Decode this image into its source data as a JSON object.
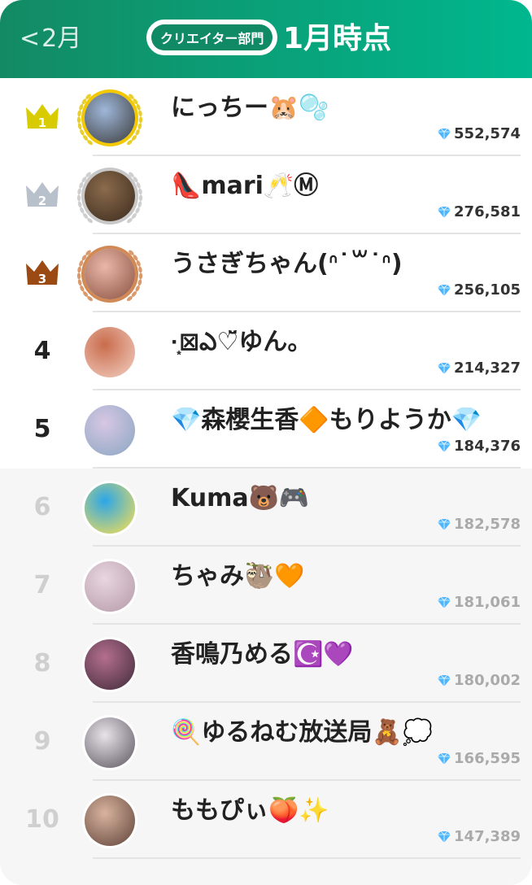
{
  "header": {
    "back_label": "2月",
    "category_pill": "クリエイター部門",
    "title": "1月時点"
  },
  "ranking": [
    {
      "rank": "1",
      "name": "にっちー🐹🫧",
      "score": "552,574",
      "tier": "gold"
    },
    {
      "rank": "2",
      "name": "👠mari🥂Ⓜ︎",
      "score": "276,581",
      "tier": "silver"
    },
    {
      "rank": "3",
      "name": "うさぎちゃん(ᐢ˙꒳˙ᐢ)",
      "score": "256,105",
      "tier": "bronze"
    },
    {
      "rank": "4",
      "name": "·͙⊠ఎ♡̆̈ゆん。",
      "score": "214,327",
      "tier": "top"
    },
    {
      "rank": "5",
      "name": "💎森櫻生香🔶もりようか💎",
      "score": "184,376",
      "tier": "top"
    },
    {
      "rank": "6",
      "name": "Kuma🐻🎮",
      "score": "182,578",
      "tier": "rest"
    },
    {
      "rank": "7",
      "name": "ちゃみ🦥🧡",
      "score": "181,061",
      "tier": "rest"
    },
    {
      "rank": "8",
      "name": "香鳴乃める☪️💜",
      "score": "180,002",
      "tier": "rest"
    },
    {
      "rank": "9",
      "name": "🍭ゆるねむ放送局🧸💭",
      "score": "166,595",
      "tier": "rest"
    },
    {
      "rank": "10",
      "name": "ももぴぃ🍑✨",
      "score": "147,389",
      "tier": "rest"
    }
  ],
  "colors": {
    "header_start": "#138a63",
    "header_end": "#00b78e",
    "gold": "#d8cc00",
    "silver": "#b8c0cc",
    "bronze": "#9a4a12",
    "gem": "#4db6ff"
  },
  "icons": {
    "back": "chevron-left-icon",
    "gem": "diamond-gem-icon",
    "crown": "crown-icon"
  }
}
